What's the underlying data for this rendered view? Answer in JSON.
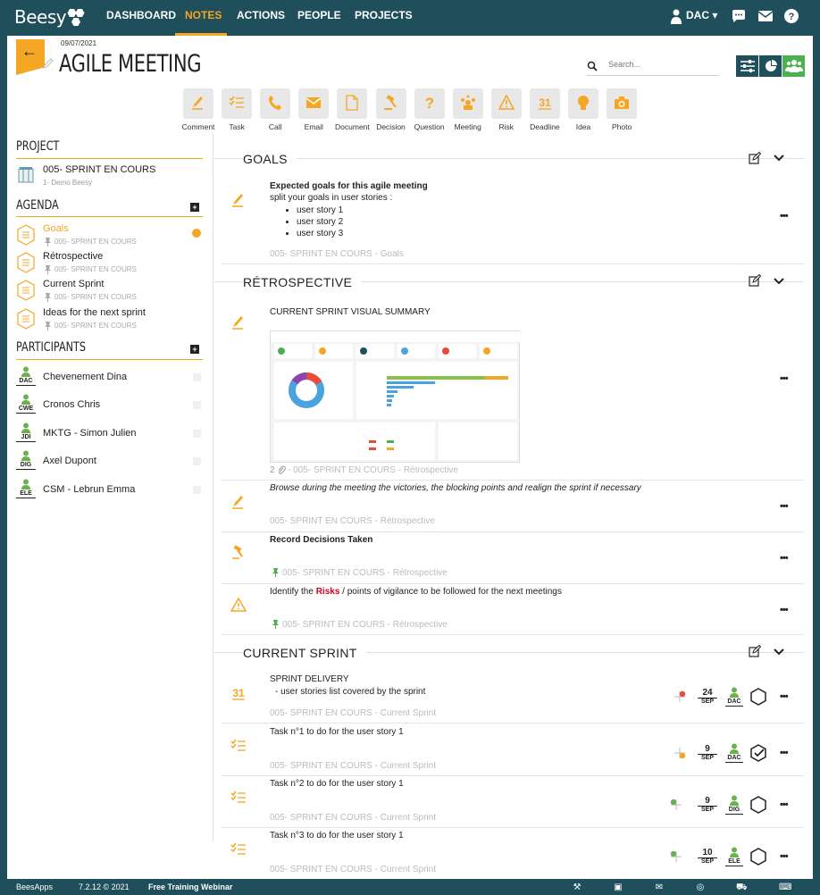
{
  "app": {
    "logo": "Beesy"
  },
  "nav": {
    "items": [
      "DASHBOARD",
      "NOTES",
      "ACTIONS",
      "PEOPLE",
      "PROJECTS"
    ],
    "active": "NOTES",
    "user": "DAC ▾"
  },
  "meeting": {
    "date": "09/07/2021",
    "title": "AGILE MEETING"
  },
  "search": {
    "placeholder": "Search..."
  },
  "toolbar": [
    {
      "label": "Comment",
      "icon": "pencil-icon"
    },
    {
      "label": "Task",
      "icon": "task-icon"
    },
    {
      "label": "Call",
      "icon": "phone-icon"
    },
    {
      "label": "Email",
      "icon": "envelope-icon"
    },
    {
      "label": "Document",
      "icon": "document-icon"
    },
    {
      "label": "Decision",
      "icon": "gavel-icon"
    },
    {
      "label": "Question",
      "icon": "question-icon"
    },
    {
      "label": "Meeting",
      "icon": "meeting-icon"
    },
    {
      "label": "Risk",
      "icon": "warning-icon"
    },
    {
      "label": "Deadline",
      "icon": "calendar-icon"
    },
    {
      "label": "Idea",
      "icon": "lightbulb-icon"
    },
    {
      "label": "Photo",
      "icon": "camera-icon"
    }
  ],
  "sidebar": {
    "project_heading": "PROJECT",
    "project_name": "005- SPRINT EN COURS",
    "project_sub": "1- Demo Beesy",
    "agenda_heading": "AGENDA",
    "agenda": [
      {
        "name": "Goals",
        "sub": "005- SPRINT EN COURS"
      },
      {
        "name": "Rétrospective",
        "sub": "005- SPRINT EN COURS"
      },
      {
        "name": "Current Sprint",
        "sub": "005- SPRINT EN COURS"
      },
      {
        "name": "Ideas for the next sprint",
        "sub": "005- SPRINT EN COURS"
      }
    ],
    "participants_heading": "PARTICIPANTS",
    "participants": [
      {
        "init": "DAC",
        "name": "Chevenement Dina"
      },
      {
        "init": "CWE",
        "name": "Cronos Chris"
      },
      {
        "init": "JDI",
        "name": "MKTG - Simon Julien"
      },
      {
        "init": "DIG",
        "name": "Axel Dupont"
      },
      {
        "init": "ELE",
        "name": "CSM - Lebrun Emma"
      }
    ]
  },
  "sections": {
    "goals": {
      "title": "GOALS",
      "note_title": "Expected goals for this agile meeting",
      "note_text": "split your goals in user stories :",
      "bullets": [
        "user story 1",
        "user story 2",
        "user story 3"
      ],
      "meta": "005- SPRINT EN COURS - Goals"
    },
    "retro": {
      "title": "RÉTROSPECTIVE",
      "notes": [
        {
          "title": "CURRENT SPRINT VISUAL SUMMARY",
          "attach": "2",
          "meta": "005- SPRINT EN COURS - Rétrospective"
        },
        {
          "text": "Browse during the meeting the victories, the blocking points and realign the sprint if necessary",
          "meta": "005- SPRINT EN COURS - Rétrospective"
        },
        {
          "title": "Record Decisions Taken",
          "meta": "005- SPRINT EN COURS - Rétrospective"
        },
        {
          "text_a": "Identify the ",
          "text_risk": "Risks",
          "text_b": " / points of vigilance to be followed for the next meetings",
          "meta": "005- SPRINT EN COURS - Rétrospective"
        }
      ]
    },
    "sprint": {
      "title": "CURRENT SPRINT",
      "notes": [
        {
          "title": "SPRINT DELIVERY",
          "text": "- user stories list covered by the sprint",
          "meta": "005- SPRINT EN COURS - Current Sprint",
          "day": "24",
          "month": "SEP",
          "assignee": "DAC"
        },
        {
          "title": "Task n°1 to do for the user story 1",
          "meta": "005- SPRINT EN COURS - Current Sprint",
          "day": "9",
          "month": "SEP",
          "assignee": "DAC"
        },
        {
          "title": "Task n°2 to do for the user story 1",
          "meta": "005- SPRINT EN COURS - Current Sprint",
          "day": "9",
          "month": "SEP",
          "assignee": "DIG"
        },
        {
          "title": "Task n°3 to do for the user story 1",
          "meta": "005- SPRINT EN COURS - Current Sprint",
          "day": "10",
          "month": "SEP",
          "assignee": "ELE"
        }
      ]
    }
  },
  "footer": {
    "brand": "BeesApps",
    "version": "7.2.12 © 2021",
    "webinar": "Free Training Webinar"
  },
  "colors": {
    "brand": "#1f4f5b",
    "accent": "#f5a623",
    "green": "#4caf50",
    "risk": "#d0021b"
  }
}
